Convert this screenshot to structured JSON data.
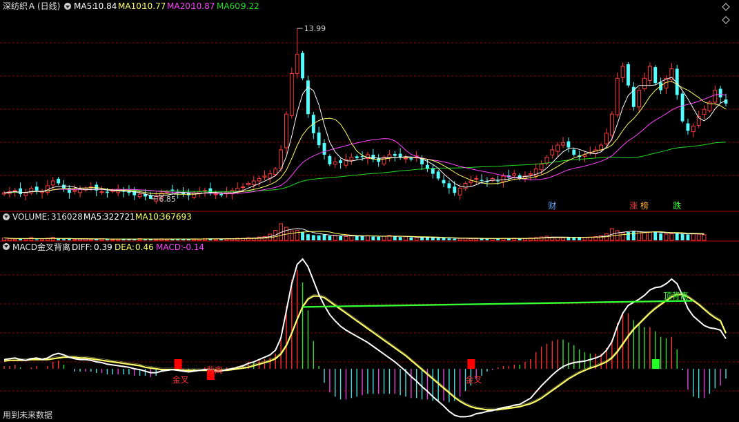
{
  "header": {
    "symbol": "深纺织Ａ",
    "period": "(日线)",
    "ma5_label": "MA5:",
    "ma5_value": "10.84",
    "ma10_label": "MA10:",
    "ma10_value": "10.77",
    "ma20_label": "MA20:",
    "ma20_value": "10.87",
    "ma60_label": "MA60:",
    "ma60_value": "9.22"
  },
  "volume_header": {
    "name": "VOLUME:",
    "value": "316028",
    "ma5_label": "MA5:",
    "ma5_value": "322721",
    "ma10_label": "MA10:",
    "ma10_value": "367693"
  },
  "macd_header": {
    "name": "MACD金叉背离",
    "diff_label": "DIFF:",
    "diff_value": "0.39",
    "dea_label": "DEA:",
    "dea_value": "0.46",
    "macd_label": "MACD:",
    "macd_value": "-0.14"
  },
  "footer_text": "用到未来数据",
  "colors": {
    "up": "#ff3b3b",
    "down": "#54ffff",
    "ma5": "#ffffff",
    "ma10": "#ffff66",
    "ma20": "#ff44ff",
    "ma60": "#22dd22",
    "grid": "#8b0000",
    "divider": "#c00000",
    "macd_pos": "#ff3333",
    "macd_pos_fade": "#33dd33",
    "macd_neg": "#44e0e0",
    "macd_neg_alt": "#dd44dd"
  },
  "icons": [
    "collapse-triangle-icon",
    "diamond-up-icon",
    "diamond-down-icon"
  ],
  "chart_data": [
    {
      "type": "candlestick",
      "panel": "price",
      "annotations": [
        {
          "text": "13.99",
          "kind": "high"
        },
        {
          "text": "6.85",
          "kind": "low"
        }
      ],
      "event_markers": [
        {
          "text": "财",
          "color": "#66aaff"
        },
        {
          "text": "涨",
          "color": "#ff3333"
        },
        {
          "text": "榜",
          "color": "#ffaa33"
        },
        {
          "text": "跌",
          "color": "#33ff33"
        }
      ],
      "ylim": [
        6.5,
        14.6
      ],
      "close": [
        7.1,
        7.15,
        7.2,
        7.05,
        7.1,
        7.3,
        7.2,
        7.15,
        7.4,
        7.6,
        7.5,
        7.3,
        7.1,
        7.2,
        7.25,
        7.3,
        7.35,
        7.2,
        7.15,
        7.1,
        7.2,
        7.25,
        7.15,
        7.1,
        7.0,
        7.05,
        6.95,
        6.85,
        6.95,
        7.1,
        7.15,
        7.2,
        7.1,
        7.05,
        7.0,
        7.1,
        7.15,
        7.2,
        7.1,
        7.05,
        7.0,
        7.15,
        7.2,
        7.3,
        7.35,
        7.5,
        7.6,
        7.7,
        7.8,
        7.9,
        8.1,
        8.9,
        10.4,
        12.1,
        12.9,
        11.9,
        10.4,
        9.6,
        9.1,
        8.7,
        8.3,
        8.4,
        8.35,
        8.5,
        8.6,
        8.55,
        8.6,
        8.7,
        8.5,
        8.4,
        8.6,
        8.7,
        8.65,
        8.6,
        8.55,
        8.5,
        8.65,
        8.3,
        8.1,
        7.9,
        7.7,
        7.5,
        7.3,
        7.1,
        7.3,
        7.5,
        7.6,
        7.7,
        7.6,
        7.55,
        7.7,
        7.6,
        7.8,
        7.75,
        7.9,
        7.7,
        7.8,
        7.9,
        8.1,
        8.3,
        8.6,
        8.9,
        9.1,
        9.2,
        9.0,
        8.7,
        8.6,
        8.7,
        8.8,
        8.9,
        9.1,
        9.6,
        10.4,
        11.9,
        12.4,
        11.6,
        10.7,
        11.4,
        11.9,
        12.4,
        11.7,
        11.4,
        11.9,
        12.3,
        11.2,
        10.1,
        9.7,
        9.9,
        10.3,
        10.6,
        10.9,
        11.4,
        11.1,
        10.84
      ]
    },
    {
      "type": "bar",
      "panel": "volume",
      "title": "VOLUME",
      "values": [
        18,
        12,
        9,
        14,
        11,
        20,
        8,
        10,
        16,
        22,
        12,
        9,
        11,
        7,
        10,
        13,
        8,
        9,
        12,
        10,
        7,
        9,
        11,
        8,
        10,
        13,
        9,
        8,
        7,
        11,
        9,
        12,
        10,
        8,
        9,
        11,
        10,
        12,
        14,
        9,
        11,
        13,
        12,
        16,
        15,
        19,
        18,
        24,
        28,
        45,
        72,
        120,
        95,
        68,
        72,
        58,
        44,
        38,
        36,
        40,
        32,
        34,
        30,
        28,
        35,
        32,
        30,
        34,
        28,
        26,
        30,
        36,
        28,
        24,
        26,
        22,
        18,
        20,
        24,
        19,
        16,
        18,
        14,
        12,
        14,
        16,
        13,
        12,
        14,
        12,
        13,
        14,
        15,
        13,
        16,
        12,
        14,
        18,
        20,
        25,
        30,
        24,
        22,
        18,
        20,
        24,
        22,
        20,
        24,
        28,
        36,
        48,
        85,
        70,
        55,
        60,
        68,
        62,
        55,
        58,
        64,
        50,
        45,
        48,
        52,
        46,
        42,
        50,
        44,
        40
      ]
    },
    {
      "type": "line",
      "panel": "macd",
      "title": "MACD金叉背离",
      "series": [
        {
          "name": "DIFF",
          "values": [
            0.12,
            0.13,
            0.14,
            0.12,
            0.11,
            0.13,
            0.14,
            0.12,
            0.14,
            0.18,
            0.2,
            0.18,
            0.15,
            0.13,
            0.12,
            0.12,
            0.11,
            0.09,
            0.08,
            0.06,
            0.05,
            0.04,
            0.03,
            0.02,
            0.0,
            -0.01,
            -0.03,
            -0.05,
            -0.05,
            -0.03,
            -0.02,
            -0.01,
            -0.02,
            -0.03,
            -0.04,
            -0.03,
            -0.02,
            -0.01,
            -0.02,
            -0.03,
            -0.03,
            -0.01,
            0.0,
            0.02,
            0.04,
            0.07,
            0.09,
            0.12,
            0.15,
            0.18,
            0.24,
            0.4,
            0.75,
            1.1,
            1.35,
            1.42,
            1.32,
            1.14,
            0.96,
            0.82,
            0.7,
            0.62,
            0.55,
            0.5,
            0.46,
            0.42,
            0.38,
            0.34,
            0.29,
            0.24,
            0.19,
            0.14,
            0.09,
            0.03,
            -0.03,
            -0.1,
            -0.16,
            -0.23,
            -0.29,
            -0.36,
            -0.42,
            -0.48,
            -0.55,
            -0.6,
            -0.62,
            -0.62,
            -0.61,
            -0.58,
            -0.57,
            -0.55,
            -0.54,
            -0.52,
            -0.5,
            -0.49,
            -0.47,
            -0.46,
            -0.42,
            -0.38,
            -0.3,
            -0.22,
            -0.15,
            -0.08,
            -0.02,
            0.03,
            0.06,
            0.08,
            0.09,
            0.1,
            0.12,
            0.14,
            0.17,
            0.24,
            0.35,
            0.55,
            0.72,
            0.82,
            0.86,
            0.9,
            0.95,
            1.02,
            1.05,
            1.06,
            1.1,
            1.16,
            1.1,
            0.95,
            0.78,
            0.68,
            0.62,
            0.56,
            0.53,
            0.52,
            0.5,
            0.39
          ]
        },
        {
          "name": "DEA",
          "values": [
            0.1,
            0.11,
            0.11,
            0.11,
            0.11,
            0.12,
            0.12,
            0.12,
            0.12,
            0.13,
            0.14,
            0.15,
            0.15,
            0.15,
            0.14,
            0.14,
            0.13,
            0.12,
            0.11,
            0.1,
            0.09,
            0.08,
            0.07,
            0.06,
            0.05,
            0.04,
            0.02,
            0.01,
            0.0,
            -0.01,
            -0.01,
            -0.01,
            -0.01,
            -0.02,
            -0.02,
            -0.02,
            -0.02,
            -0.02,
            -0.02,
            -0.02,
            -0.02,
            -0.02,
            -0.01,
            0.0,
            0.01,
            0.02,
            0.04,
            0.06,
            0.08,
            0.1,
            0.13,
            0.19,
            0.3,
            0.46,
            0.64,
            0.8,
            0.9,
            0.94,
            0.94,
            0.92,
            0.87,
            0.82,
            0.77,
            0.72,
            0.67,
            0.62,
            0.57,
            0.52,
            0.47,
            0.42,
            0.37,
            0.32,
            0.27,
            0.22,
            0.17,
            0.11,
            0.05,
            -0.01,
            -0.07,
            -0.13,
            -0.19,
            -0.25,
            -0.31,
            -0.37,
            -0.42,
            -0.46,
            -0.49,
            -0.51,
            -0.52,
            -0.53,
            -0.53,
            -0.53,
            -0.52,
            -0.51,
            -0.5,
            -0.49,
            -0.47,
            -0.45,
            -0.42,
            -0.38,
            -0.33,
            -0.28,
            -0.23,
            -0.18,
            -0.13,
            -0.09,
            -0.05,
            -0.02,
            0.01,
            0.03,
            0.06,
            0.09,
            0.14,
            0.22,
            0.32,
            0.42,
            0.51,
            0.58,
            0.65,
            0.72,
            0.78,
            0.83,
            0.88,
            0.93,
            0.96,
            0.96,
            0.93,
            0.88,
            0.83,
            0.77,
            0.71,
            0.66,
            0.62,
            0.46
          ]
        }
      ],
      "markers": [
        {
          "text": "金叉"
        },
        {
          "text": "背离"
        },
        {
          "text": "金叉"
        },
        {
          "text": "顶背离"
        }
      ]
    }
  ]
}
